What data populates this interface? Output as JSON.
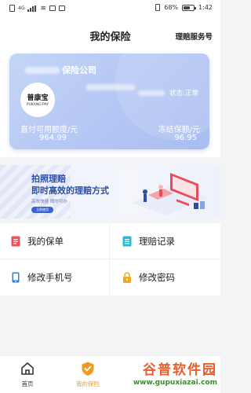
{
  "status_bar": {
    "signal_text": "4G",
    "battery_percent": 68,
    "battery_text": "68%",
    "time": "1:42"
  },
  "header": {
    "title": "我的保险",
    "right_action": "理赔服务号"
  },
  "card": {
    "company_suffix": "保险公司",
    "status": "状态:正常",
    "logo_cn": "普康宝",
    "logo_en": "PUKANG PAY",
    "available_label": "直付可用额度/元",
    "available_value": "964.99",
    "frozen_label": "冻结保额/元",
    "frozen_value": "96.95"
  },
  "banner": {
    "line1": "拍照理赔",
    "line2": "即时高效的理赔方式",
    "line3": "高效快捷  随时可办",
    "button": "立即使用"
  },
  "menu": {
    "items": [
      {
        "label": "我的保单",
        "icon": "policy-doc-icon",
        "color": "#f0505a"
      },
      {
        "label": "理赔记录",
        "icon": "claim-record-icon",
        "color": "#29b8d6"
      },
      {
        "label": "修改手机号",
        "icon": "phone-icon",
        "color": "#2f7fd8"
      },
      {
        "label": "修改密码",
        "icon": "lock-icon",
        "color": "#f5a623"
      }
    ]
  },
  "tabbar": {
    "tabs": [
      {
        "label": "首页",
        "icon": "home-icon"
      },
      {
        "label": "我的保险",
        "icon": "shield-check-icon",
        "active": true
      }
    ],
    "active_color": "#f39a1e"
  },
  "watermark": {
    "title": "谷普软件园",
    "url": "www.gupuxiazai.com"
  }
}
